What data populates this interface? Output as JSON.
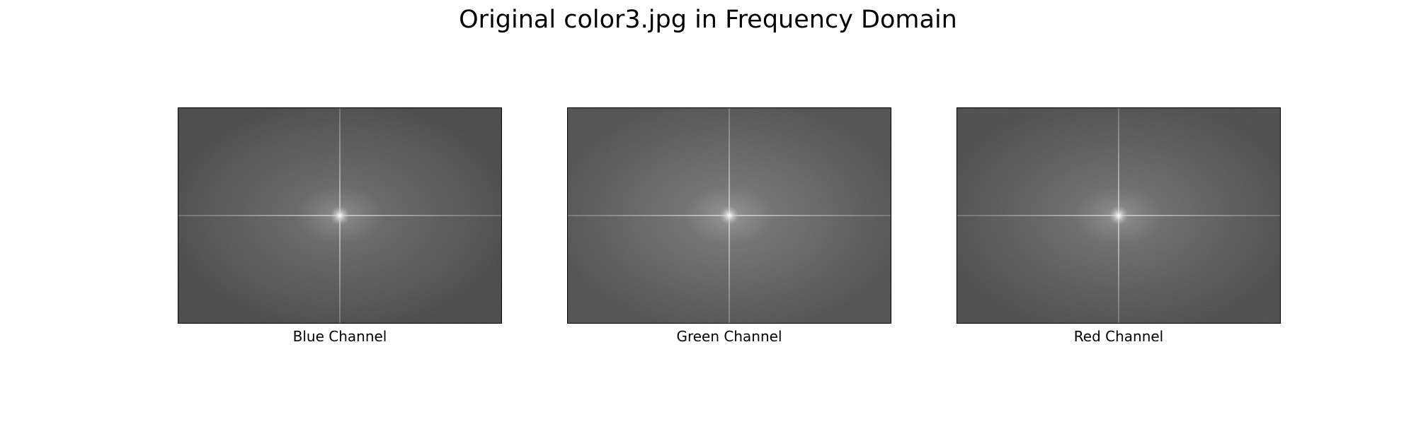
{
  "figure": {
    "title": "Original color3.jpg in Frequency Domain"
  },
  "panels": [
    {
      "caption": "Blue Channel",
      "tone": "#555555"
    },
    {
      "caption": "Green Channel",
      "tone": "#5d5d5d"
    },
    {
      "caption": "Red Channel",
      "tone": "#585858"
    }
  ]
}
